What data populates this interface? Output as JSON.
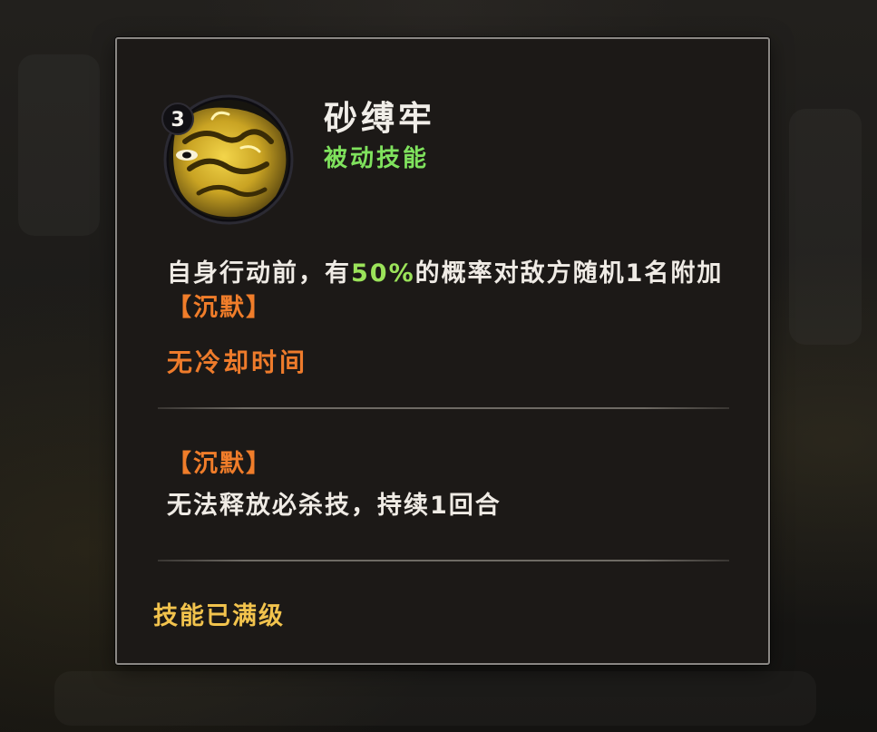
{
  "skill": {
    "level": "3",
    "name": "砂缚牢",
    "type": "被动技能",
    "description": {
      "part1": "自身行动前，有",
      "chance": "50%",
      "part2": "的概率对敌方随机1名附加",
      "status_tag": "【沉默】"
    },
    "cooldown": "无冷却时间",
    "icon": "sand-fist-icon"
  },
  "status_effect": {
    "name": "【沉默】",
    "description": "无法释放必杀技，持续1回合"
  },
  "footer": {
    "max_level_text": "技能已满级"
  },
  "colors": {
    "panel_bg": "#1c1917",
    "panel_border": "#8a8784",
    "title": "#f1eee9",
    "passive_green": "#7fe25d",
    "chance_green": "#9be35a",
    "status_orange": "#f07d2a",
    "cooldown_orange": "#ee7b2b",
    "max_level_gold": "#f2c34d",
    "icon_gold": "#d9b62c"
  }
}
